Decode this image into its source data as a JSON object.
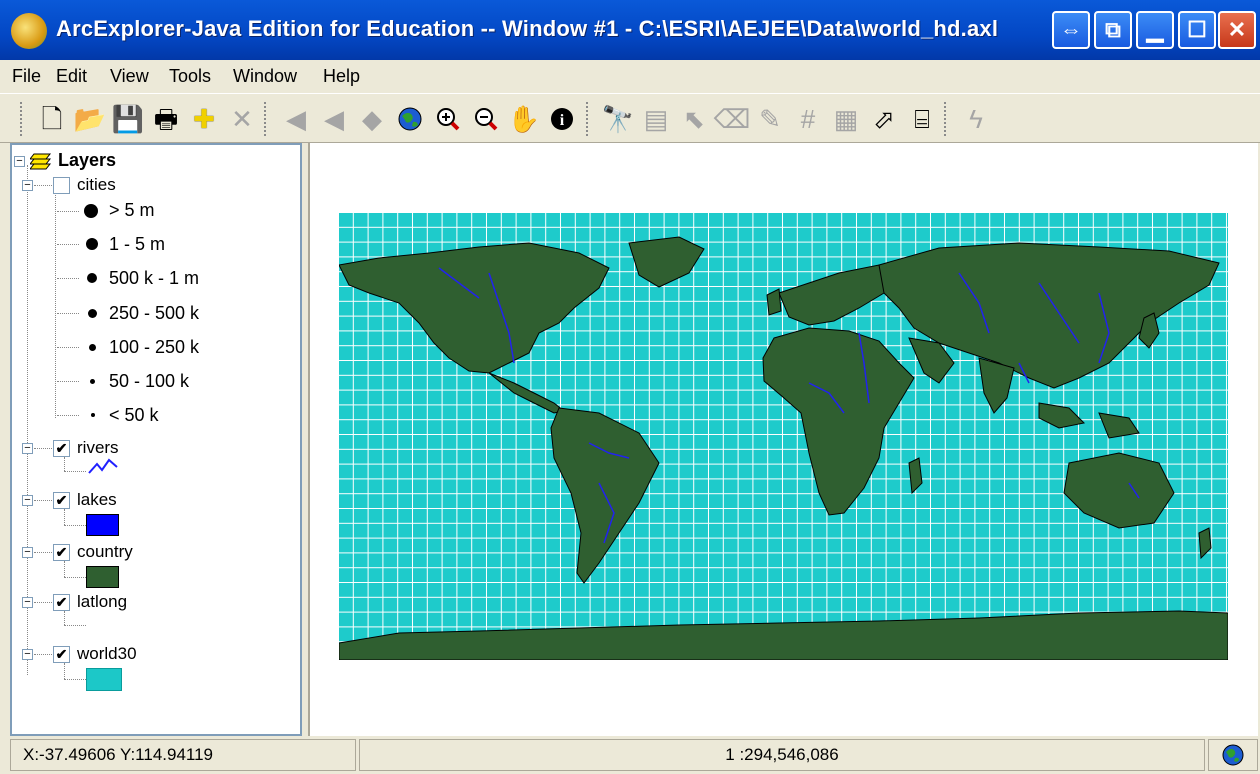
{
  "window": {
    "title": "ArcExplorer-Java Edition for Education -- Window #1 - C:\\ESRI\\AEJEE\\Data\\world_hd.axl",
    "buttons": [
      "restore-special",
      "tile",
      "minimize",
      "maximize",
      "close"
    ]
  },
  "menubar": {
    "items": [
      "File",
      "Edit",
      "View",
      "Tools",
      "Window",
      "Help"
    ]
  },
  "toolbar": {
    "tools": [
      "new-icon",
      "open-icon",
      "save-icon",
      "print-icon",
      "add-layer-icon",
      "remove-layer-icon",
      "back-extent-icon",
      "forward-extent-icon",
      "zoom-active-icon",
      "full-extent-globe-icon",
      "zoom-in-icon",
      "zoom-out-icon",
      "pan-hand-icon",
      "identify-icon",
      "find-icon",
      "query-icon",
      "select-icon",
      "clear-selection-icon",
      "measure-icon",
      "attribute-table-icon",
      "hotlink-icon",
      "label-icon",
      "lightning-icon"
    ]
  },
  "legend": {
    "root": "Layers",
    "layers": [
      {
        "name": "cities",
        "checked": false,
        "classes": [
          "> 5 m",
          "1 - 5 m",
          "500 k - 1 m",
          "250 - 500 k",
          "100 - 250 k",
          "50 - 100 k",
          "< 50 k"
        ]
      },
      {
        "name": "rivers",
        "checked": true,
        "symbol": "line",
        "color": "#2020FF"
      },
      {
        "name": "lakes",
        "checked": true,
        "symbol": "fill",
        "color": "#0000FF"
      },
      {
        "name": "country",
        "checked": true,
        "symbol": "fill",
        "color": "#2F5F30"
      },
      {
        "name": "latlong",
        "checked": true,
        "symbol": "none"
      },
      {
        "name": "world30",
        "checked": true,
        "symbol": "fill",
        "color": "#1CC8C8"
      }
    ]
  },
  "map": {
    "ocean_color": "#1ECBCB",
    "grid_color": "#FFFFFF",
    "land_color": "#2F5F30",
    "river_color": "#2222EE"
  },
  "status": {
    "coords": "X:-37.49606 Y:114.94119",
    "scale": "1 :294,546,086"
  }
}
